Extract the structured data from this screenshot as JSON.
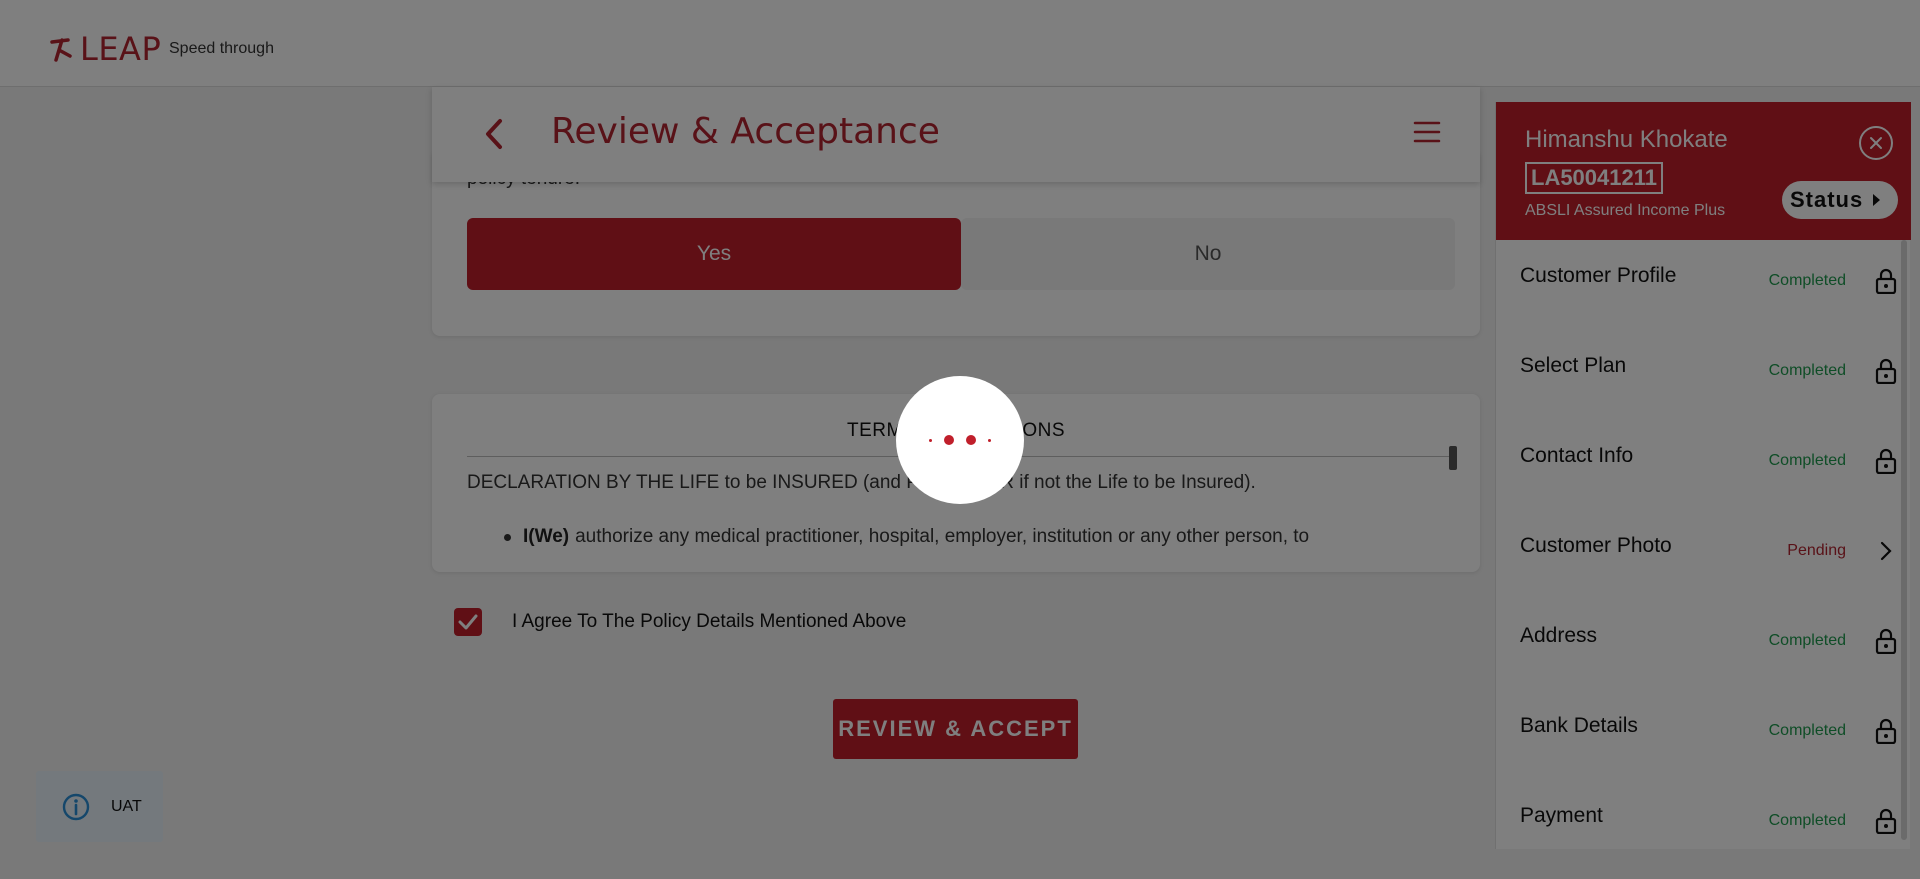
{
  "header": {
    "logo_text": "LEAP",
    "tagline": "Speed through"
  },
  "page": {
    "title": "Review & Acceptance"
  },
  "question": {
    "text_fragment": "policy tenure.",
    "yes_label": "Yes",
    "no_label": "No",
    "selected": "Yes"
  },
  "terms": {
    "title": "TERMS & CONDITIONS",
    "declaration": "DECLARATION BY THE LIFE to be INSURED (and PROPOSER if not the Life to be Insured).",
    "bullet_bold": "I(We)",
    "bullet_text": "authorize any medical practitioner, hospital, employer, institution or any other person, to"
  },
  "agreement": {
    "label": "I Agree To The Policy Details Mentioned Above",
    "checked": true
  },
  "review_button": "REVIEW & ACCEPT",
  "side": {
    "customer_name": "Himanshu Khokate",
    "application_id": "LA50041211",
    "plan": "ABSLI Assured Income Plus",
    "status_label": "Status",
    "items": [
      {
        "label": "Customer Profile",
        "status": "Completed",
        "icon": "lock-icon"
      },
      {
        "label": "Select Plan",
        "status": "Completed",
        "icon": "lock-icon"
      },
      {
        "label": "Contact Info",
        "status": "Completed",
        "icon": "lock-icon"
      },
      {
        "label": "Customer Photo",
        "status": "Pending",
        "icon": "chevron-right-icon"
      },
      {
        "label": "Address",
        "status": "Completed",
        "icon": "lock-icon"
      },
      {
        "label": "Bank Details",
        "status": "Completed",
        "icon": "lock-icon"
      },
      {
        "label": "Payment",
        "status": "Completed",
        "icon": "lock-icon"
      }
    ]
  },
  "env_badge": "UAT",
  "colors": {
    "brand": "#c01f2b",
    "completed": "#1e9b4e",
    "pending": "#b32530"
  }
}
